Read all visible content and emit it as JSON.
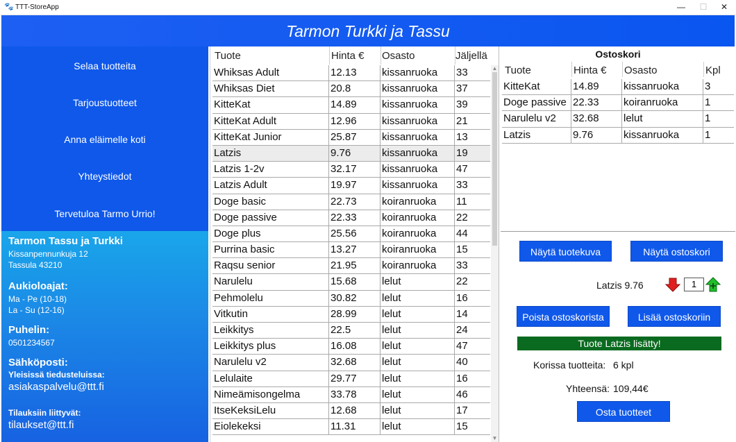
{
  "window": {
    "app_icon": "paw-icon",
    "title": "TTT-StoreApp",
    "controls": [
      "—",
      "☐",
      "✕"
    ]
  },
  "banner": {
    "title": "Tarmon Turkki ja Tassu"
  },
  "nav": {
    "items": [
      {
        "label": "Selaa tuotteita"
      },
      {
        "label": "Tarjoustuotteet"
      },
      {
        "label": "Anna eläimelle koti"
      },
      {
        "label": "Yhteystiedot"
      },
      {
        "label": "Tervetuloa Tarmo Urrio!"
      }
    ]
  },
  "info": {
    "company": "Tarmon Tassu ja Turkki",
    "street": "Kissanpennunkuja 12",
    "city": "Tassula 43210",
    "hours_title": "Aukioloajat:",
    "hours_weekday": "Ma - Pe (10-18)",
    "hours_weekend": "La - Su (12-16)",
    "phone_title": "Puhelin:",
    "phone": "0501234567",
    "email_title": "Sähköposti:",
    "general_label": "Yleisissä tiedusteluissa:",
    "general_email": "asiakaspalvelu@ttt.fi",
    "orders_label": "Tilauksiin liittyvät:",
    "orders_email": "tilaukset@ttt.fi"
  },
  "products": {
    "headers": [
      "Tuote",
      "Hinta €",
      "Osasto",
      "Jäljellä"
    ],
    "rows": [
      [
        "Whiksas Adult",
        "12.13",
        "kissanruoka",
        "33"
      ],
      [
        "Whiksas Diet",
        "20.8",
        "kissanruoka",
        "37"
      ],
      [
        "KitteKat",
        "14.89",
        "kissanruoka",
        "39"
      ],
      [
        "KitteKat Adult",
        "12.96",
        "kissanruoka",
        "21"
      ],
      [
        "KitteKat Junior",
        "25.87",
        "kissanruoka",
        "13"
      ],
      [
        "Latzis",
        "9.76",
        "kissanruoka",
        "19"
      ],
      [
        "Latzis 1-2v",
        "32.17",
        "kissanruoka",
        "47"
      ],
      [
        "Latzis Adult",
        "19.97",
        "kissanruoka",
        "33"
      ],
      [
        "Doge basic",
        "22.73",
        "koiranruoka",
        "11"
      ],
      [
        "Doge passive",
        "22.33",
        "koiranruoka",
        "22"
      ],
      [
        "Doge plus",
        "25.56",
        "koiranruoka",
        "44"
      ],
      [
        "Purrina basic",
        "13.27",
        "koiranruoka",
        "15"
      ],
      [
        "Raqsu senior",
        "21.95",
        "koiranruoka",
        "33"
      ],
      [
        "Narulelu",
        "15.68",
        "lelut",
        "22"
      ],
      [
        "Pehmolelu",
        "30.82",
        "lelut",
        "16"
      ],
      [
        "Vitkutin",
        "28.99",
        "lelut",
        "14"
      ],
      [
        "Leikkitys",
        "22.5",
        "lelut",
        "24"
      ],
      [
        "Leikkitys plus",
        "16.08",
        "lelut",
        "47"
      ],
      [
        "Narulelu v2",
        "32.68",
        "lelut",
        "40"
      ],
      [
        "Lelulaite",
        "29.77",
        "lelut",
        "16"
      ],
      [
        "Nimeämisongelma",
        "33.78",
        "lelut",
        "46"
      ],
      [
        "ItseKeksiLelu",
        "12.68",
        "lelut",
        "17"
      ],
      [
        "Eiolekeksi",
        "11.31",
        "lelut",
        "15"
      ]
    ],
    "selected_index": 5
  },
  "cart": {
    "title": "Ostoskori",
    "headers": [
      "Tuote",
      "Hinta €",
      "Osasto",
      "Kpl"
    ],
    "rows": [
      [
        "KitteKat",
        "14.89",
        "kissanruoka",
        "3"
      ],
      [
        "Doge passive",
        "22.33",
        "koiranruoka",
        "1"
      ],
      [
        "Narulelu v2",
        "32.68",
        "lelut",
        "1"
      ],
      [
        "Latzis",
        "9.76",
        "kissanruoka",
        "1"
      ]
    ]
  },
  "actions": {
    "show_image": "Näytä tuotekuva",
    "show_cart": "Näytä ostoskori",
    "selected_item": "Latzis 9.76",
    "quantity": "1",
    "remove": "Poista ostoskorista",
    "add": "Lisää ostoskoriin",
    "status": "Tuote Latzis lisätty!",
    "count_label": "Korissa tuotteita:",
    "count_value": "6 kpl",
    "total_label": "Yhteensä:",
    "total_value": "109,44€",
    "buy": "Osta tuotteet"
  },
  "colors": {
    "nav_blue": "#0f58ea",
    "status_green": "#0a6a1f",
    "arrow_red": "#e02020",
    "arrow_green": "#1fbf2a"
  }
}
